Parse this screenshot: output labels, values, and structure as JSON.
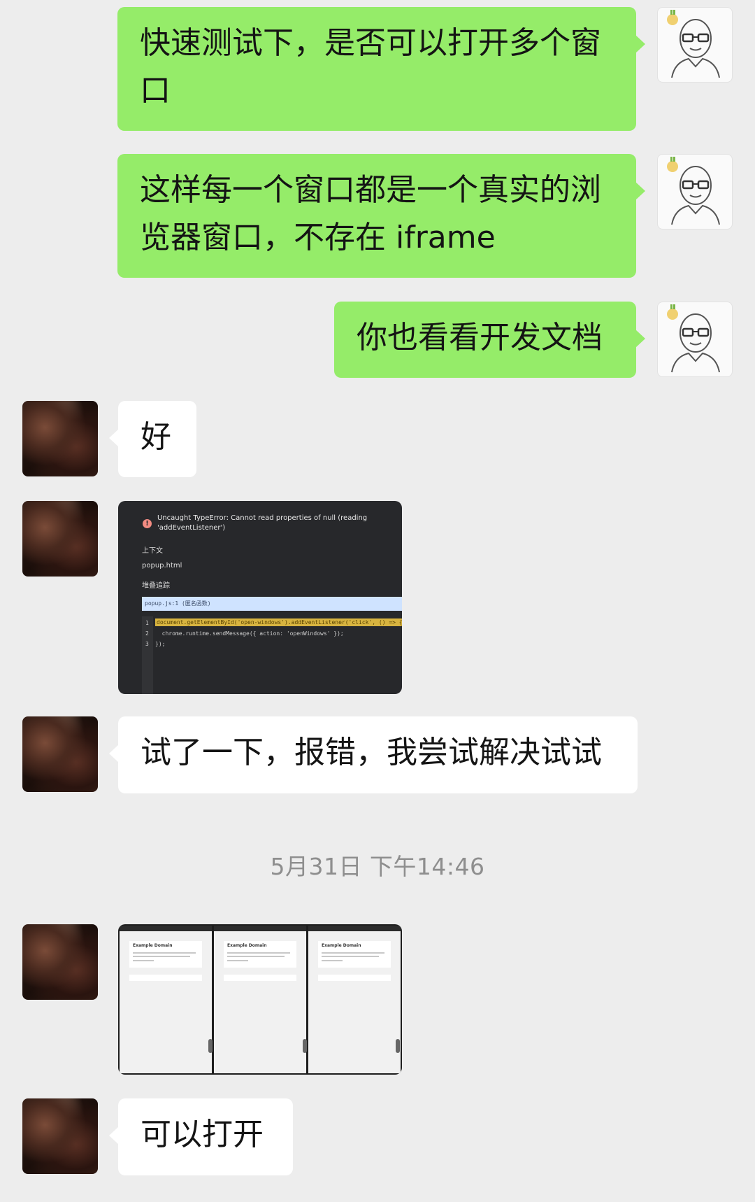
{
  "messages": {
    "m1": "快速测试下，是否可以打开多个窗口",
    "m2_line1": "这样每一个窗口都是一个真实的浏",
    "m2_line2": "览器窗口，不存在 iframe",
    "m3": "你也看看开发文档",
    "m4": "好",
    "m6": "试了一下，报错，我尝试解决试试",
    "m8": "可以打开"
  },
  "m1_lines": [
    "快速测试下，是否可以打开多个窗",
    "口"
  ],
  "error_screenshot": {
    "error_line1": "Uncaught TypeError: Cannot read properties of null (reading",
    "error_line2": "'addEventListener')",
    "context_label": "上下文",
    "context_value": "popup.html",
    "stack_label": "堆叠追踪",
    "stack_frame": "popup.js:1 (匿名函数)",
    "code_lines": [
      "document.getElementById('open-windows').addEventListener('click', () => {",
      "  chrome.runtime.sendMessage({ action: 'openWindows' });",
      "});"
    ],
    "line_numbers": [
      "1",
      "2",
      "3"
    ]
  },
  "timestamp": "5月31日 下午14:46",
  "windows_screenshot": {
    "window_titles": [
      "Example Domain",
      "Example Domain",
      "Example Domain"
    ]
  },
  "colors": {
    "sent_bubble": "#95ec69",
    "received_bubble": "#ffffff",
    "background": "#ededed"
  }
}
